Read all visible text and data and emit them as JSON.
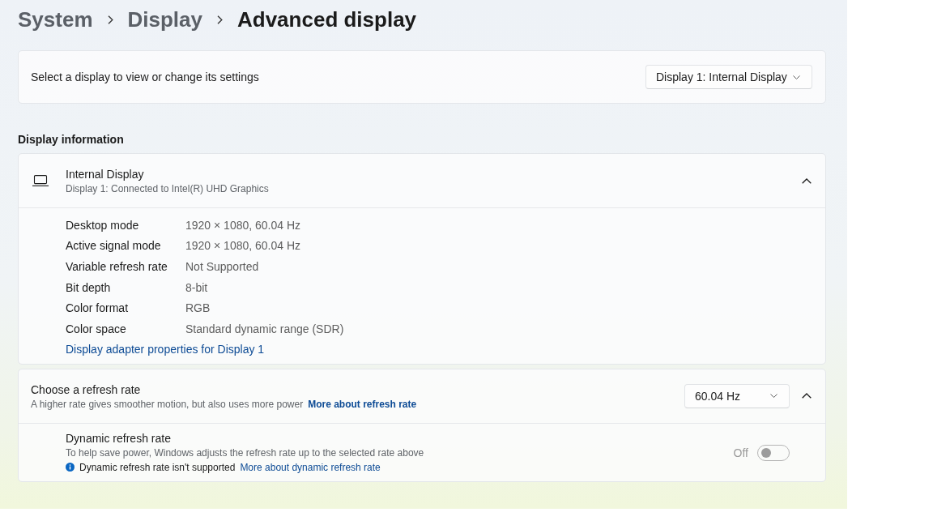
{
  "breadcrumb": [
    {
      "label": "System",
      "current": false
    },
    {
      "label": "Display",
      "current": false
    },
    {
      "label": "Advanced display",
      "current": true
    }
  ],
  "display_selector": {
    "label": "Select a display to view or change its settings",
    "dropdown": {
      "value": "Display 1: Internal Display"
    }
  },
  "display_information": {
    "heading": "Display information",
    "device": {
      "title": "Internal Display",
      "subtitle": "Display 1: Connected to Intel(R) UHD Graphics",
      "expanded": true
    },
    "rows": [
      {
        "label": "Desktop mode",
        "value": "1920 × 1080, 60.04 Hz"
      },
      {
        "label": "Active signal mode",
        "value": "1920 × 1080, 60.04 Hz"
      },
      {
        "label": "Variable refresh rate",
        "value": "Not Supported"
      },
      {
        "label": "Bit depth",
        "value": "8-bit"
      },
      {
        "label": "Color format",
        "value": "RGB"
      },
      {
        "label": "Color space",
        "value": "Standard dynamic range (SDR)"
      }
    ],
    "link": "Display adapter properties for Display 1"
  },
  "refresh_rate": {
    "title": "Choose a refresh rate",
    "description": "A higher rate gives smoother motion, but also uses more power",
    "link": "More about refresh rate",
    "dropdown": {
      "value": "60.04 Hz"
    },
    "expanded": true,
    "dynamic": {
      "title": "Dynamic refresh rate",
      "description": "To help save power, Windows adjusts the refresh rate up to the selected rate above",
      "info": "Dynamic refresh rate isn't supported",
      "info_link": "More about dynamic refresh rate",
      "state_label": "Off",
      "on": false
    }
  }
}
